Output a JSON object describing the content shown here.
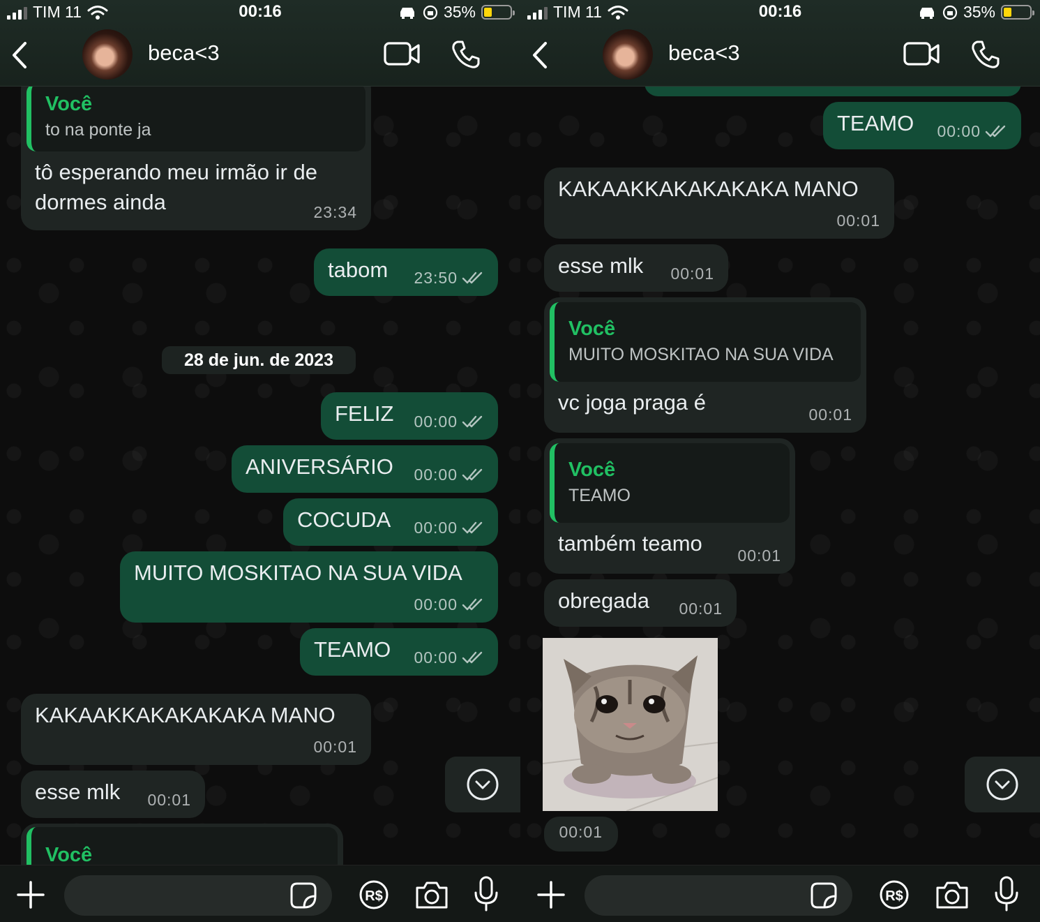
{
  "left": {
    "status": {
      "carrier": "TIM 11",
      "time": "00:16",
      "battery": "35%"
    },
    "header": {
      "name": "beca<3"
    },
    "date_pill": "28 de jun. de 2023",
    "messages": [
      {
        "quote_name": "Você",
        "quote_text": "to na ponte ja",
        "text": "tô esperando meu irmão ir de dormes ainda",
        "time": "23:34"
      },
      {
        "text": "tabom",
        "time": "23:50"
      },
      {
        "text": "FELIZ",
        "time": "00:00"
      },
      {
        "text": "ANIVERSÁRIO",
        "time": "00:00"
      },
      {
        "text": "COCUDA",
        "time": "00:00"
      },
      {
        "text": "MUITO MOSKITAO NA SUA VIDA",
        "time": "00:00"
      },
      {
        "text": "TEAMO",
        "time": "00:00"
      },
      {
        "text": "KAKAAKKAKAKAKAKA MANO",
        "time": "00:01"
      },
      {
        "text": "esse mlk",
        "time": "00:01"
      },
      {
        "quote_name": "Você"
      }
    ]
  },
  "right": {
    "status": {
      "carrier": "TIM 11",
      "time": "00:16",
      "battery": "35%"
    },
    "header": {
      "name": "beca<3"
    },
    "messages": [
      {
        "text": "TEAMO",
        "time": "00:00"
      },
      {
        "text": "KAKAAKKAKAKAKAKA MANO",
        "time": "00:01"
      },
      {
        "text": "esse mlk",
        "time": "00:01"
      },
      {
        "quote_name": "Você",
        "quote_text": "MUITO MOSKITAO NA SUA VIDA",
        "text": "vc joga praga é",
        "time": "00:01"
      },
      {
        "quote_name": "Você",
        "quote_text": "TEAMO",
        "text": "também teamo",
        "time": "00:01"
      },
      {
        "text": "obregada",
        "time": "00:01"
      },
      {
        "time": "00:01"
      }
    ]
  },
  "colors": {
    "outgoing": "#134d37",
    "incoming": "#1f2523",
    "accent": "#21c063"
  },
  "icons": [
    "back-chevron-icon",
    "video-call-icon",
    "phone-icon",
    "scroll-down-icon",
    "plus-icon",
    "sticker-icon",
    "pix-payment-icon",
    "camera-icon",
    "microphone-icon",
    "double-check-icon"
  ]
}
